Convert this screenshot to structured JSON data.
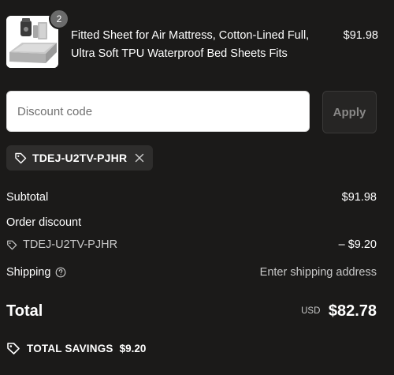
{
  "cart": {
    "item": {
      "title_line1": "Fitted Sheet for Air Mattress, Cotton-Lined Full,",
      "title_line2": "Ultra Soft TPU Waterproof Bed Sheets Fits",
      "price": "$91.98",
      "quantity": "2",
      "image_icon": "product-thumbnail-air-mattress-sheet"
    }
  },
  "discount": {
    "placeholder": "Discount code",
    "value": "",
    "apply_label": "Apply",
    "applied_code": "TDEJ-U2TV-PJHR"
  },
  "summary": {
    "subtotal_label": "Subtotal",
    "subtotal_value": "$91.98",
    "order_discount_label": "Order discount",
    "discount_code": "TDEJ-U2TV-PJHR",
    "discount_value": "– $9.20",
    "shipping_label": "Shipping",
    "shipping_value": "Enter shipping address",
    "total_label": "Total",
    "total_currency": "USD",
    "total_value": "$82.78",
    "savings_label": "TOTAL SAVINGS",
    "savings_value": "$9.20"
  },
  "colors": {
    "background": "#1b1a19",
    "text": "#ffffff",
    "muted_text": "#c8c8c8",
    "apply_button_bg": "#262524",
    "chip_bg": "#2e2d2c",
    "badge_bg": "#6b6b6b"
  }
}
